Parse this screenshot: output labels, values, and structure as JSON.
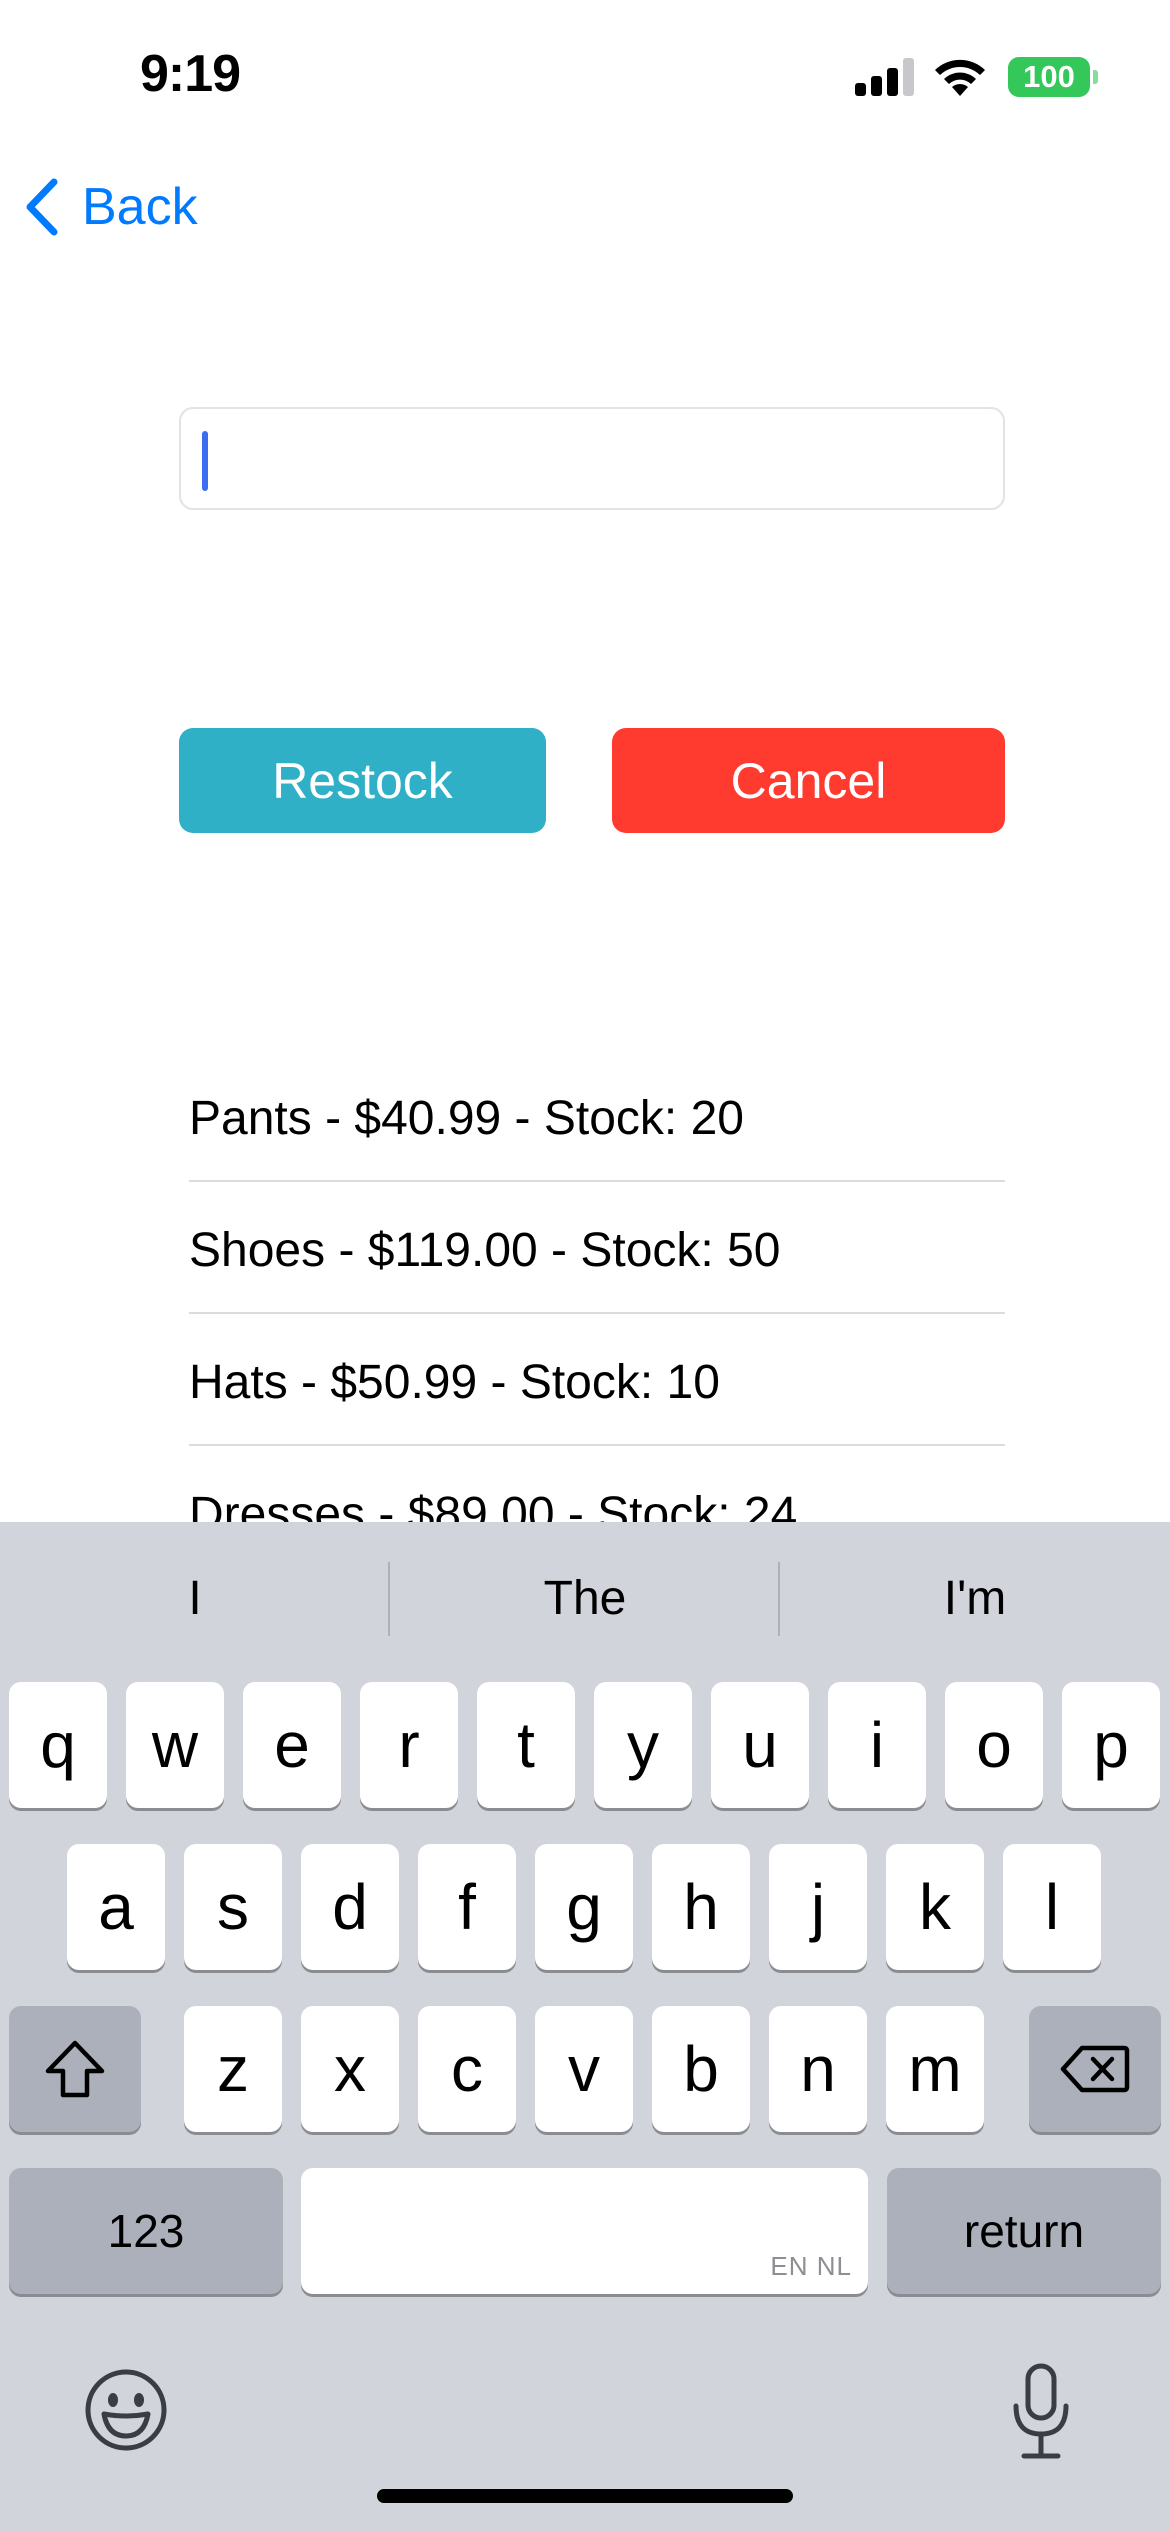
{
  "status_bar": {
    "time": "9:19",
    "battery": "100",
    "signal_bars": 3,
    "signal_max": 4
  },
  "nav": {
    "back_label": "Back"
  },
  "input": {
    "value": "",
    "placeholder": ""
  },
  "buttons": {
    "restock_label": "Restock",
    "cancel_label": "Cancel"
  },
  "products": [
    {
      "label": "Pants - $40.99 - Stock: 20"
    },
    {
      "label": "Shoes - $119.00 - Stock: 50"
    },
    {
      "label": "Hats - $50.99 - Stock: 10"
    },
    {
      "label": "Dresses - $89.00 - Stock: 24"
    }
  ],
  "keyboard": {
    "suggestions": [
      "I",
      "The",
      "I'm"
    ],
    "row1": [
      "q",
      "w",
      "e",
      "r",
      "t",
      "y",
      "u",
      "i",
      "o",
      "p"
    ],
    "row2": [
      "a",
      "s",
      "d",
      "f",
      "g",
      "h",
      "j",
      "k",
      "l"
    ],
    "row3": [
      "z",
      "x",
      "c",
      "v",
      "b",
      "n",
      "m"
    ],
    "numbers_label": "123",
    "return_label": "return",
    "space_languages": "EN NL"
  },
  "colors": {
    "accent": "#007aff",
    "restock": "#30b0c7",
    "cancel": "#ff3b30",
    "battery": "#34c759",
    "keyboard_bg": "#d1d4db"
  },
  "icons": [
    "chevron-left-icon",
    "signal-icon",
    "wifi-icon",
    "battery-icon",
    "shift-icon",
    "backspace-icon",
    "emoji-icon",
    "microphone-icon"
  ]
}
